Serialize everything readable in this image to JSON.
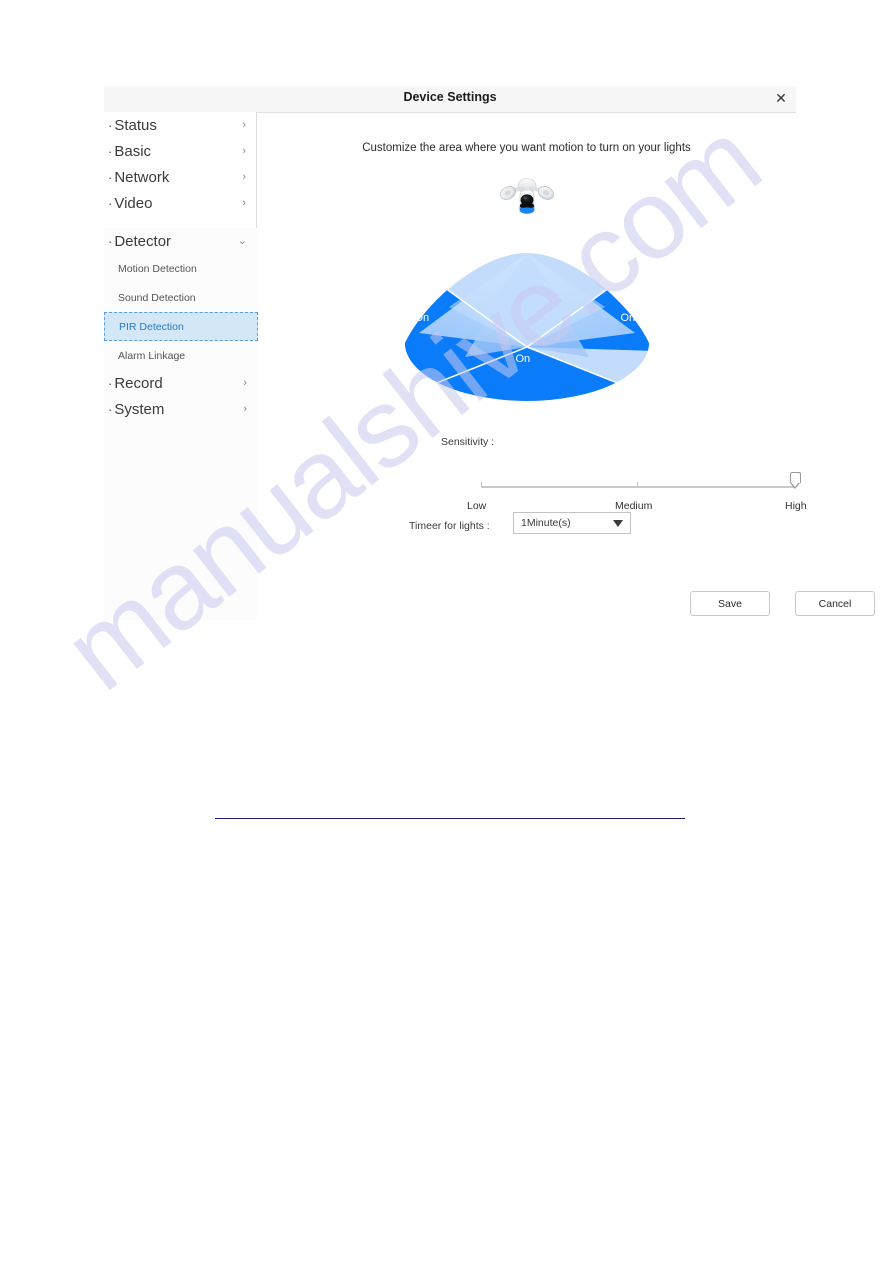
{
  "dialog": {
    "title": "Device Settings",
    "close_icon": "close-icon"
  },
  "sidebar": {
    "items": [
      {
        "label": "Status",
        "chevron": "›",
        "type": "top"
      },
      {
        "label": "Basic",
        "chevron": "›",
        "type": "top"
      },
      {
        "label": "Network",
        "chevron": "›",
        "type": "top"
      },
      {
        "label": "Video",
        "chevron": "›",
        "type": "top"
      },
      {
        "label": "Detector",
        "chevron": "⌄",
        "type": "top",
        "expanded": true
      },
      {
        "label": "Motion Detection",
        "type": "sub"
      },
      {
        "label": "Sound Detection",
        "type": "sub"
      },
      {
        "label": "PIR Detection",
        "type": "sub",
        "active": true
      },
      {
        "label": "Alarm Linkage",
        "type": "sub"
      },
      {
        "label": "Record",
        "chevron": "›",
        "type": "top"
      },
      {
        "label": "System",
        "chevron": "›",
        "type": "top"
      }
    ],
    "active_item": "PIR Detection",
    "dot": "·"
  },
  "main": {
    "hint": "Customize the area where you want motion to turn on your lights",
    "device_icon": "floodlight-camera-icon",
    "zones": [
      {
        "id": "zone-left",
        "label": "On",
        "state": "on"
      },
      {
        "id": "zone-center",
        "label": "On",
        "state": "on"
      },
      {
        "id": "zone-right",
        "label": "On",
        "state": "on"
      }
    ],
    "zone_colors": {
      "active": "#0a7cfa",
      "beam_light": "#b9d8fb",
      "beam_mid": "#8fc0f8",
      "beam_dark": "#6aa9f5",
      "divider": "#ffffff"
    },
    "sensitivity": {
      "label": "Sensitivity :",
      "value": "High",
      "value_percent": 100,
      "scale": [
        "Low",
        "Medium",
        "High"
      ]
    },
    "timer": {
      "label": "Timeer for lights :",
      "value": "1Minute(s)",
      "arrow_icon": "chevron-down-icon"
    },
    "buttons": {
      "save": "Save",
      "cancel": "Cancel"
    }
  },
  "watermark": {
    "text": "manualshive.com"
  }
}
